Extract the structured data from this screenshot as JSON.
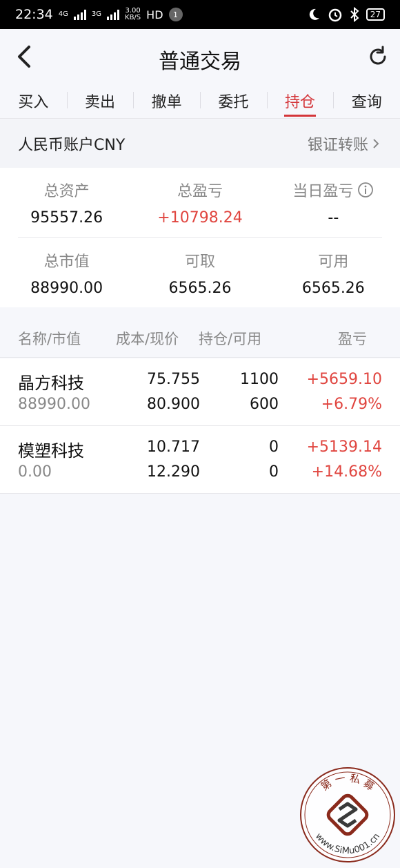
{
  "status_bar": {
    "time": "22:34",
    "network1": "4G",
    "network2": "3G",
    "speed": "3.00",
    "speed_unit": "KB/S",
    "hd": "HD",
    "notification_count": "1",
    "battery": "27"
  },
  "header": {
    "title": "普通交易",
    "back_icon": "chevron-left-icon",
    "refresh_icon": "refresh-icon"
  },
  "tabs": [
    {
      "label": "买入",
      "active": false
    },
    {
      "label": "卖出",
      "active": false
    },
    {
      "label": "撤单",
      "active": false
    },
    {
      "label": "委托",
      "active": false
    },
    {
      "label": "持仓",
      "active": true
    },
    {
      "label": "查询",
      "active": false
    }
  ],
  "account": {
    "label": "人民币账户CNY",
    "transfer_link": "银证转账"
  },
  "summary": {
    "total_assets_label": "总资产",
    "total_assets": "95557.26",
    "total_pl_label": "总盈亏",
    "total_pl": "+10798.24",
    "daily_pl_label": "当日盈亏",
    "daily_pl": "--",
    "market_value_label": "总市值",
    "market_value": "88990.00",
    "withdrawable_label": "可取",
    "withdrawable": "6565.26",
    "available_label": "可用",
    "available": "6565.26"
  },
  "list_header": {
    "name_mv": "名称/市值",
    "cost_price": "成本/现价",
    "position_avail": "持仓/可用",
    "pl": "盈亏"
  },
  "holdings": [
    {
      "name": "晶方科技",
      "market_value": "88990.00",
      "cost": "75.755",
      "price": "80.900",
      "position": "1100",
      "available": "600",
      "pl": "+5659.10",
      "pl_pct": "+6.79%"
    },
    {
      "name": "模塑科技",
      "market_value": "0.00",
      "cost": "10.717",
      "price": "12.290",
      "position": "0",
      "available": "0",
      "pl": "+5139.14",
      "pl_pct": "+14.68%"
    }
  ],
  "watermark": {
    "top_text": "第 一 私 募",
    "bottom_text": "www.SiMu001.cn"
  },
  "colors": {
    "accent_red": "#d4363a",
    "profit_red": "#e0453f",
    "background": "#f6f7fb"
  }
}
